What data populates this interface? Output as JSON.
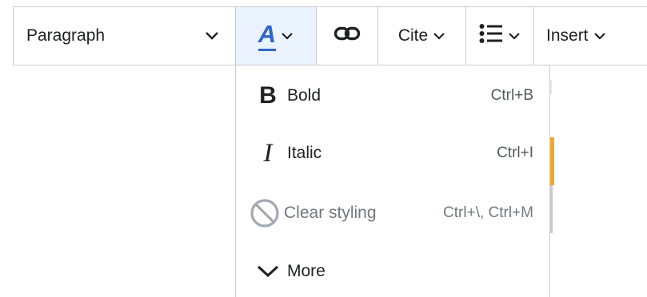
{
  "toolbar": {
    "paragraph_label": "Paragraph",
    "cite_label": "Cite",
    "insert_label": "Insert",
    "style_glyph": "A"
  },
  "style_menu": {
    "items": [
      {
        "label": "Bold",
        "shortcut": "Ctrl+B",
        "glyph": "B",
        "icon": "bold-icon",
        "disabled": false
      },
      {
        "label": "Italic",
        "shortcut": "Ctrl+I",
        "glyph": "I",
        "icon": "italic-icon",
        "disabled": false
      },
      {
        "label": "Clear styling",
        "shortcut": "Ctrl+\\, Ctrl+M",
        "icon": "clear-styling-icon",
        "disabled": true
      },
      {
        "label": "More",
        "shortcut": "",
        "icon": "chevron-down-icon",
        "disabled": false
      }
    ]
  },
  "colors": {
    "accent": "#3366cc",
    "active_bg": "#eaf3ff",
    "border": "#c8ccd1",
    "text": "#202122",
    "disabled_text": "#72777d",
    "edge_highlight": "#f0a82a"
  }
}
